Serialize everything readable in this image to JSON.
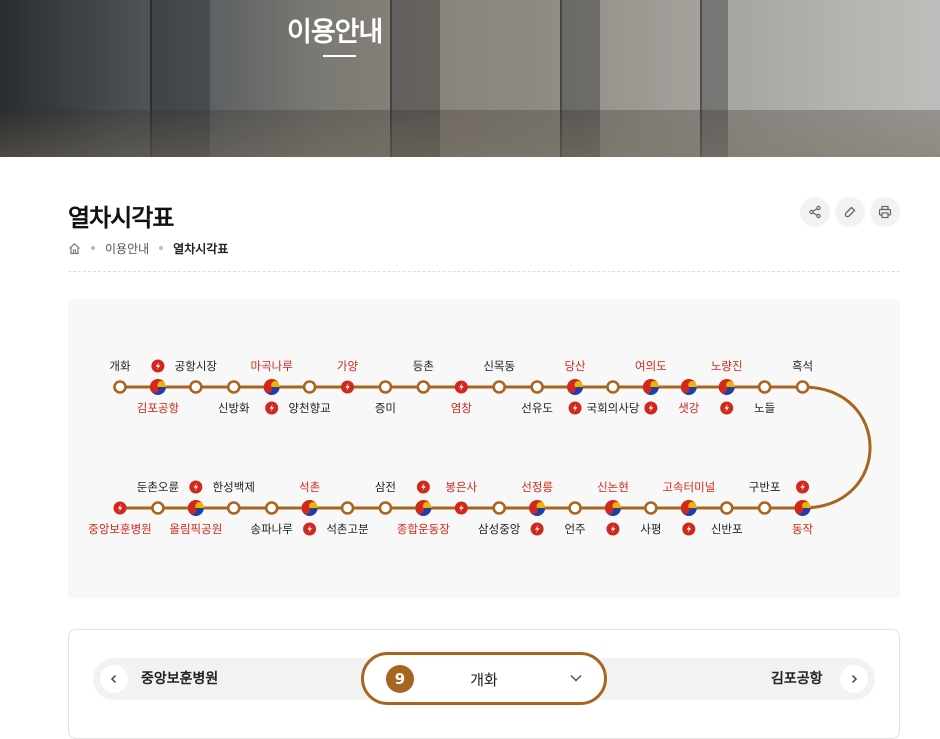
{
  "hero": {
    "title": "이용안내"
  },
  "page": {
    "title": "열차시각표",
    "tools": [
      {
        "name": "share-icon"
      },
      {
        "name": "link-icon"
      },
      {
        "name": "print-icon"
      }
    ]
  },
  "breadcrumb": {
    "home": "home-icon",
    "section": "이용안내",
    "current": "열차시각표"
  },
  "route_map": {
    "line_color": "#a8651f",
    "express_color": "#d0281c",
    "row1": [
      {
        "name": "개화",
        "label": "top",
        "type": "normal",
        "express": false
      },
      {
        "name": "김포공항",
        "label": "bottom",
        "type": "transfer",
        "express": true
      },
      {
        "name": "공항시장",
        "label": "top",
        "type": "normal",
        "express": false
      },
      {
        "name": "신방화",
        "label": "bottom",
        "type": "normal",
        "express": false
      },
      {
        "name": "마곡나루",
        "label": "top",
        "type": "transfer",
        "express": true
      },
      {
        "name": "양천향교",
        "label": "bottom",
        "type": "normal",
        "express": false
      },
      {
        "name": "가양",
        "label": "top",
        "type": "express_stop",
        "express": true
      },
      {
        "name": "증미",
        "label": "bottom",
        "type": "normal",
        "express": false
      },
      {
        "name": "등촌",
        "label": "top",
        "type": "normal",
        "express": false
      },
      {
        "name": "염창",
        "label": "bottom",
        "type": "express_stop",
        "express": true
      },
      {
        "name": "신목동",
        "label": "top",
        "type": "normal",
        "express": false
      },
      {
        "name": "선유도",
        "label": "bottom",
        "type": "normal",
        "express": false
      },
      {
        "name": "당산",
        "label": "top",
        "type": "transfer",
        "express": true
      },
      {
        "name": "국회의사당",
        "label": "bottom",
        "type": "normal",
        "express": false
      },
      {
        "name": "여의도",
        "label": "top",
        "type": "transfer",
        "express": true
      },
      {
        "name": "샛강",
        "label": "bottom",
        "type": "transfer",
        "express": false
      },
      {
        "name": "노량진",
        "label": "top",
        "type": "transfer",
        "express": true
      },
      {
        "name": "노들",
        "label": "bottom",
        "type": "normal",
        "express": false
      },
      {
        "name": "흑석",
        "label": "top",
        "type": "normal",
        "express": false
      }
    ],
    "row2": [
      {
        "name": "중앙보훈병원",
        "label": "bottom",
        "type": "express_stop",
        "express": true
      },
      {
        "name": "둔촌오륜",
        "label": "top",
        "type": "normal",
        "express": false
      },
      {
        "name": "올림픽공원",
        "label": "bottom",
        "type": "transfer",
        "express": true
      },
      {
        "name": "한성백제",
        "label": "top",
        "type": "normal",
        "express": false
      },
      {
        "name": "송파나루",
        "label": "bottom",
        "type": "normal",
        "express": false
      },
      {
        "name": "석촌",
        "label": "top",
        "type": "transfer",
        "express": true
      },
      {
        "name": "석촌고분",
        "label": "bottom",
        "type": "normal",
        "express": false
      },
      {
        "name": "삼전",
        "label": "top",
        "type": "normal",
        "express": false
      },
      {
        "name": "종합운동장",
        "label": "bottom",
        "type": "transfer",
        "express": true
      },
      {
        "name": "봉은사",
        "label": "top",
        "type": "express_stop",
        "express": true
      },
      {
        "name": "삼성중앙",
        "label": "bottom",
        "type": "normal",
        "express": false
      },
      {
        "name": "선정릉",
        "label": "top",
        "type": "transfer",
        "express": true
      },
      {
        "name": "언주",
        "label": "bottom",
        "type": "normal",
        "express": false
      },
      {
        "name": "신논현",
        "label": "top",
        "type": "transfer",
        "express": true
      },
      {
        "name": "사평",
        "label": "bottom",
        "type": "normal",
        "express": false
      },
      {
        "name": "고속터미널",
        "label": "top",
        "type": "transfer",
        "express": true
      },
      {
        "name": "신반포",
        "label": "bottom",
        "type": "normal",
        "express": false
      },
      {
        "name": "구반포",
        "label": "top",
        "type": "normal",
        "express": false
      },
      {
        "name": "동작",
        "label": "bottom",
        "type": "transfer",
        "express": true
      }
    ]
  },
  "selector": {
    "prev_label": "중앙보훈병원",
    "next_label": "김포공항",
    "line_number": "9",
    "station": "개화",
    "line_color": "#a8651f"
  }
}
